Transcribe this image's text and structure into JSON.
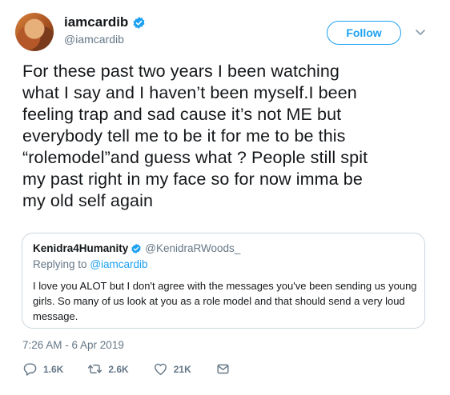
{
  "author": {
    "display_name": "iamcardib",
    "handle": "@iamcardib",
    "verified": true
  },
  "follow_label": "Follow",
  "tweet": {
    "lines": [
      "For these past two years I been watching",
      "what I say and I haven’t been myself.I been",
      "feeling trap and sad cause it’s not ME but",
      "everybody tell me to be it for me to be this",
      "“rolemodel”and guess what ? People still spit",
      "my past right in my face so for now imma be",
      "my old self again"
    ],
    "timestamp": "7:26 AM - 6 Apr 2019"
  },
  "quoted_tweet": {
    "display_name": "Kenidra4Humanity",
    "handle": "@KenidraRWoods_",
    "verified": true,
    "replying_prefix": "Replying to",
    "replying_to": "@iamcardib",
    "lines": [
      "I love you ALOT but I don't agree with the messages you've been sending us young",
      "girls. So many of us look at you as a role model and that should send a very loud",
      "message."
    ]
  },
  "actions": {
    "replies": "1.6K",
    "retweets": "2.6K",
    "likes": "21K"
  },
  "colors": {
    "accent": "#1da1f2",
    "secondary_text": "#657786",
    "border": "#ccd6dd"
  },
  "icons": [
    "verified-badge-icon",
    "chevron-down-icon",
    "reply-icon",
    "retweet-icon",
    "like-icon",
    "direct-message-icon"
  ]
}
